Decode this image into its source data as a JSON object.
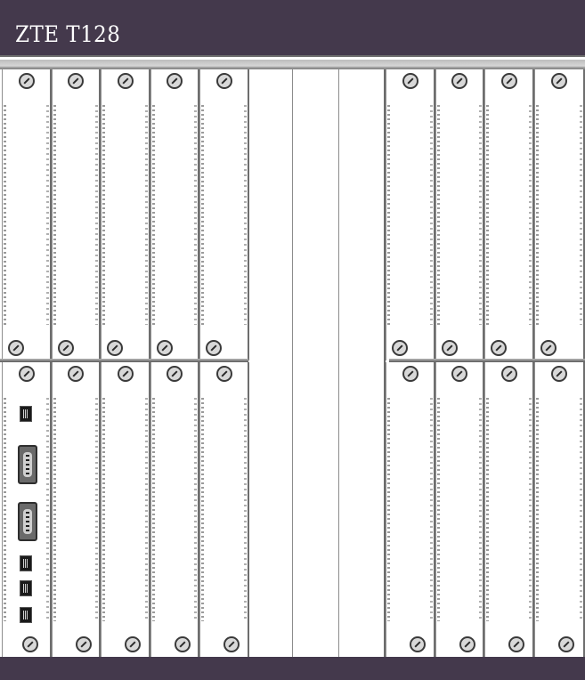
{
  "window": {
    "title": "ZTE  T128"
  },
  "chassis": {
    "upper_left_slots": 5,
    "upper_right_slots": 4,
    "lower_left_slots": 5,
    "lower_right_slots": 4,
    "empty_center_slots": 3
  },
  "colors": {
    "frame": "#44394c",
    "panel": "#ffffff",
    "rail": "#808080",
    "screw": "#3a3a3a"
  },
  "ports": [
    {
      "type": "rj45",
      "name": "ethernet-port-1"
    },
    {
      "type": "db9",
      "name": "serial-port-1"
    },
    {
      "type": "db9",
      "name": "serial-port-2"
    },
    {
      "type": "rj45",
      "name": "ethernet-port-2"
    },
    {
      "type": "rj45",
      "name": "ethernet-port-3"
    },
    {
      "type": "rj45",
      "name": "ethernet-port-4"
    }
  ]
}
